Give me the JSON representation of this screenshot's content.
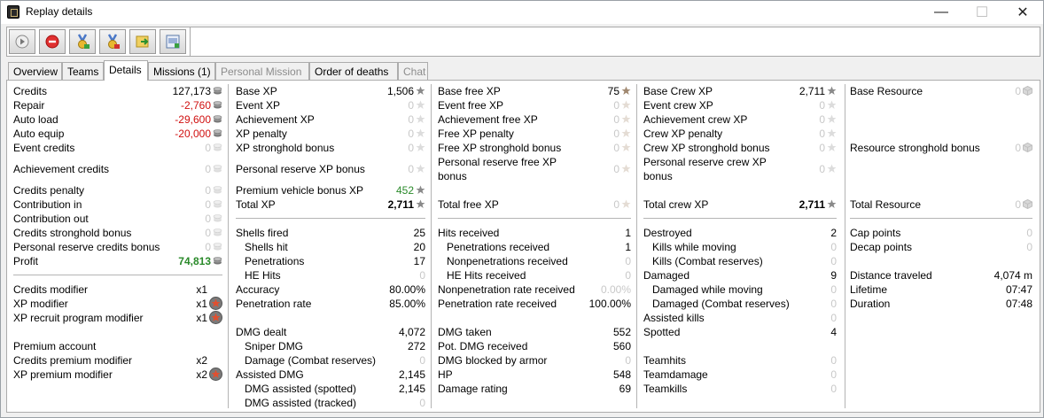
{
  "window": {
    "title": "Replay details"
  },
  "tabs": [
    "Overview",
    "Teams",
    "Details",
    "Missions (1)",
    "Personal Mission",
    "Order of deaths",
    "Chat"
  ],
  "colors": {
    "negative": "#d01010",
    "positive": "#2a8a2a",
    "zero": "#c8c8c8"
  },
  "credits": {
    "credits": {
      "label": "Credits",
      "value": "127,173"
    },
    "repair": {
      "label": "Repair",
      "value": "-2,760"
    },
    "auto_load": {
      "label": "Auto load",
      "value": "-29,600"
    },
    "auto_equip": {
      "label": "Auto equip",
      "value": "-20,000"
    },
    "event_credits": {
      "label": "Event credits",
      "value": "0"
    },
    "achievement_credits": {
      "label": "Achievement credits",
      "value": "0"
    },
    "credits_penalty": {
      "label": "Credits penalty",
      "value": "0"
    },
    "contribution_in": {
      "label": "Contribution in",
      "value": "0"
    },
    "contribution_out": {
      "label": "Contribution out",
      "value": "0"
    },
    "credits_stronghold": {
      "label": "Credits stronghold bonus",
      "value": "0"
    },
    "personal_reserve_credits": {
      "label": "Personal reserve credits bonus",
      "value": "0"
    },
    "profit": {
      "label": "Profit",
      "value": "74,813"
    },
    "credits_modifier": {
      "label": "Credits modifier",
      "value": "x1"
    },
    "xp_modifier": {
      "label": "XP modifier",
      "value": "x1"
    },
    "xp_recruit_modifier": {
      "label": "XP recruit program modifier",
      "value": "x1"
    },
    "premium_account": {
      "label": "Premium account"
    },
    "credits_premium_modifier": {
      "label": "Credits premium modifier",
      "value": "x2"
    },
    "xp_premium_modifier": {
      "label": "XP premium modifier",
      "value": "x2"
    }
  },
  "xp": {
    "base_xp": {
      "label": "Base XP",
      "value": "1,506"
    },
    "event_xp": {
      "label": "Event XP",
      "value": "0"
    },
    "achievement_xp": {
      "label": "Achievement XP",
      "value": "0"
    },
    "xp_penalty": {
      "label": "XP penalty",
      "value": "0"
    },
    "xp_stronghold": {
      "label": "XP stronghold bonus",
      "value": "0"
    },
    "personal_reserve_xp": {
      "label": "Personal reserve XP bonus",
      "value": "0"
    },
    "premium_vehicle_bonus": {
      "label": "Premium vehicle bonus XP",
      "value": "452"
    },
    "total_xp": {
      "label": "Total XP",
      "value": "2,711"
    }
  },
  "free_xp": {
    "base_free_xp": {
      "label": "Base free XP",
      "value": "75"
    },
    "event_free_xp": {
      "label": "Event free XP",
      "value": "0"
    },
    "achievement_free_xp": {
      "label": "Achievement free XP",
      "value": "0"
    },
    "free_xp_penalty": {
      "label": "Free XP penalty",
      "value": "0"
    },
    "free_xp_stronghold": {
      "label": "Free XP stronghold bonus",
      "value": "0"
    },
    "personal_reserve_free_xp": {
      "label": "Personal reserve free XP",
      "label2": "bonus",
      "value": "0"
    },
    "total_free_xp": {
      "label": "Total free XP",
      "value": "0"
    }
  },
  "crew_xp": {
    "base_crew_xp": {
      "label": "Base Crew XP",
      "value": "2,711"
    },
    "event_crew_xp": {
      "label": "Event crew XP",
      "value": "0"
    },
    "achievement_crew_xp": {
      "label": "Achievement crew XP",
      "value": "0"
    },
    "crew_xp_penalty": {
      "label": "Crew XP penalty",
      "value": "0"
    },
    "crew_xp_stronghold": {
      "label": "Crew XP stronghold bonus",
      "value": "0"
    },
    "personal_reserve_crew_xp": {
      "label": "Personal reserve crew XP",
      "label2": "bonus",
      "value": "0"
    },
    "total_crew_xp": {
      "label": "Total crew XP",
      "value": "2,711"
    }
  },
  "resource": {
    "base_resource": {
      "label": "Base Resource",
      "value": "0"
    },
    "resource_stronghold": {
      "label": "Resource stronghold bonus",
      "value": "0"
    },
    "total_resource": {
      "label": "Total Resource",
      "value": "0"
    }
  },
  "shooting": {
    "shells_fired": {
      "label": "Shells fired",
      "value": "25"
    },
    "shells_hit": {
      "label": "Shells hit",
      "value": "20"
    },
    "penetrations": {
      "label": "Penetrations",
      "value": "17"
    },
    "he_hits": {
      "label": "HE Hits",
      "value": "0"
    },
    "accuracy": {
      "label": "Accuracy",
      "value": "80.00%"
    },
    "penetration_rate": {
      "label": "Penetration rate",
      "value": "85.00%"
    },
    "dmg_dealt": {
      "label": "DMG dealt",
      "value": "4,072"
    },
    "sniper_dmg": {
      "label": "Sniper DMG",
      "value": "272"
    },
    "damage_combat_reserves": {
      "label": "Damage (Combat reserves)",
      "value": "0"
    },
    "assisted_dmg": {
      "label": "Assisted DMG",
      "value": "2,145"
    },
    "dmg_assisted_spotted": {
      "label": "DMG assisted (spotted)",
      "value": "2,145"
    },
    "dmg_assisted_tracked": {
      "label": "DMG assisted (tracked)",
      "value": "0"
    }
  },
  "received": {
    "hits_received": {
      "label": "Hits received",
      "value": "1"
    },
    "penetrations_received": {
      "label": "Penetrations received",
      "value": "1"
    },
    "nonpenetrations_received": {
      "label": "Nonpenetrations received",
      "value": "0"
    },
    "he_hits_received": {
      "label": "HE Hits received",
      "value": "0"
    },
    "nonpen_rate_received": {
      "label": "Nonpenetration rate received",
      "value": "0.00%"
    },
    "pen_rate_received": {
      "label": "Penetration rate received",
      "value": "100.00%"
    },
    "dmg_taken": {
      "label": "DMG taken",
      "value": "552"
    },
    "pot_dmg_received": {
      "label": "Pot. DMG received",
      "value": "560"
    },
    "dmg_blocked": {
      "label": "DMG blocked by armor",
      "value": "0"
    },
    "hp": {
      "label": "HP",
      "value": "548"
    },
    "damage_rating": {
      "label": "Damage rating",
      "value": "69"
    }
  },
  "kills": {
    "destroyed": {
      "label": "Destroyed",
      "value": "2"
    },
    "kills_while_moving": {
      "label": "Kills while moving",
      "value": "0"
    },
    "kills_combat_reserves": {
      "label": "Kills (Combat reserves)",
      "value": "0"
    },
    "damaged": {
      "label": "Damaged",
      "value": "9"
    },
    "damaged_while_moving": {
      "label": "Damaged while moving",
      "value": "0"
    },
    "damaged_combat_reserves": {
      "label": "Damaged (Combat reserves)",
      "value": "0"
    },
    "assisted_kills": {
      "label": "Assisted kills",
      "value": "0"
    },
    "spotted": {
      "label": "Spotted",
      "value": "4"
    },
    "teamhits": {
      "label": "Teamhits",
      "value": "0"
    },
    "teamdamage": {
      "label": "Teamdamage",
      "value": "0"
    },
    "teamkills": {
      "label": "Teamkills",
      "value": "0"
    }
  },
  "misc": {
    "cap_points": {
      "label": "Cap points",
      "value": "0"
    },
    "decap_points": {
      "label": "Decap points",
      "value": "0"
    },
    "distance": {
      "label": "Distance traveled",
      "value": "4,074 m"
    },
    "lifetime": {
      "label": "Lifetime",
      "value": "07:47"
    },
    "duration": {
      "label": "Duration",
      "value": "07:48"
    }
  }
}
